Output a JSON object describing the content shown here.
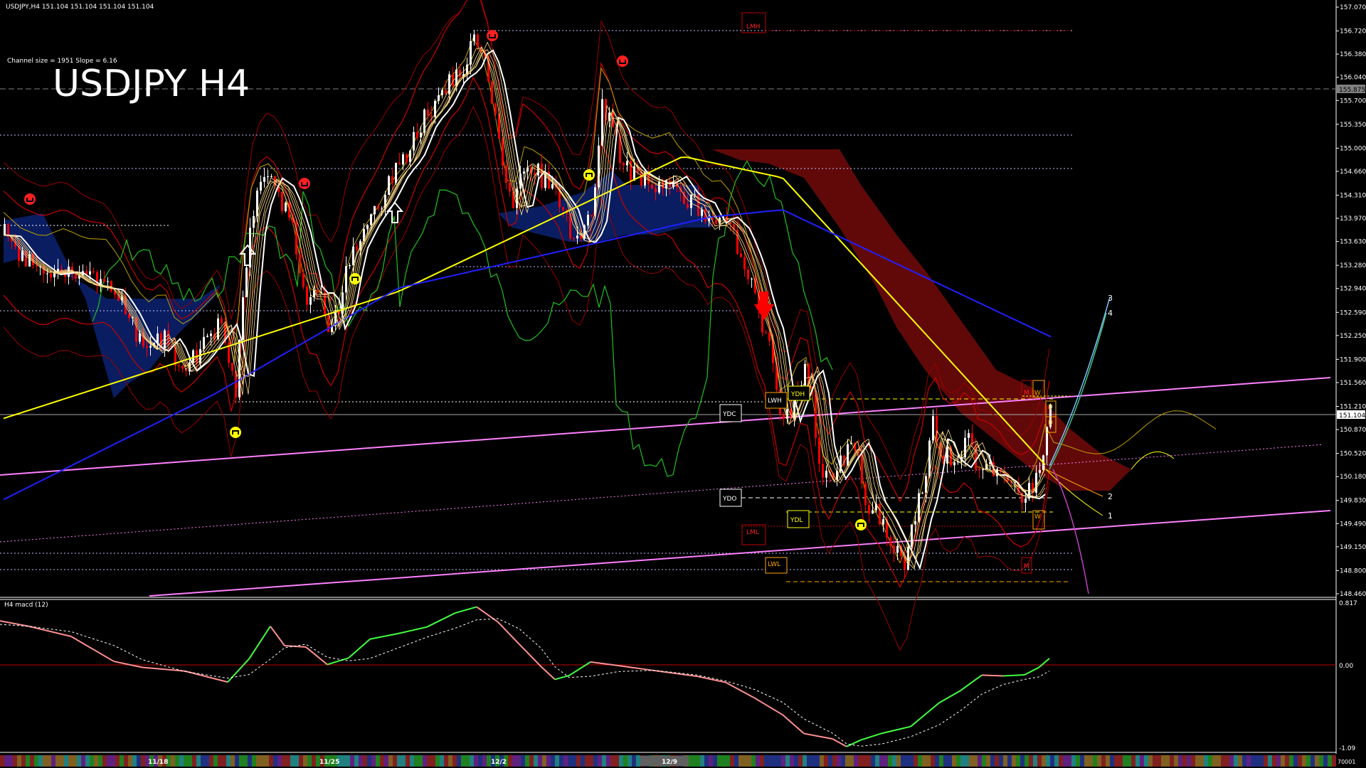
{
  "header": {
    "symbol_line": "USDJPY,H4  151.104 151.104 151.104 151.104",
    "big_title": "USDJPY H4",
    "channel_info": "Channel size = 1951 Slope = 6.16"
  },
  "price_axis": {
    "ticks": [
      "157.070",
      "156.720",
      "156.380",
      "156.040",
      "155.700",
      "155.350",
      "155.000",
      "154.660",
      "154.310",
      "153.970",
      "153.630",
      "153.280",
      "152.940",
      "152.590",
      "152.250",
      "151.900",
      "151.560",
      "151.210",
      "150.870",
      "150.520",
      "150.180",
      "149.830",
      "149.490",
      "149.150",
      "148.800",
      "148.460"
    ],
    "current_price": "151.104",
    "upper_line_price": "155.875"
  },
  "macd_panel": {
    "title": "H4  macd (12)",
    "ticks": [
      "0.817",
      "0.00",
      "-1.09"
    ]
  },
  "time_axis": {
    "dates": [
      "11/18",
      "11/25",
      "12/2",
      "12/9"
    ],
    "bottom_right_label": "70001"
  },
  "level_labels": {
    "lmh": "LMH",
    "lml": "LML",
    "ydc": "YDC",
    "ydo": "YDO",
    "ydl": "YDL",
    "ydh": "YDH",
    "lwh": "LWH",
    "lwl": "LWL",
    "m_top": "M",
    "m_bottom": "M",
    "w_top": "W",
    "w_bottom": "W",
    "d1": "D",
    "d2": "D"
  },
  "projection_labels": [
    "3",
    "4",
    "2",
    "1"
  ],
  "colors": {
    "background": "#000000",
    "bull_candle": "#ffffff",
    "bear_candle": "#ff0000",
    "ma_white": "#ffffff",
    "ma_yellow": "#ffff00",
    "ma_blue": "#2020ff",
    "channel": "#ff80ff",
    "macd_line_up": "#40ff40",
    "macd_line_down": "#ff9090",
    "cloud_red": "#ff2020",
    "cloud_blue": "#2040ff",
    "bollinger": "#cc0000",
    "green_ind": "#20c020"
  }
}
